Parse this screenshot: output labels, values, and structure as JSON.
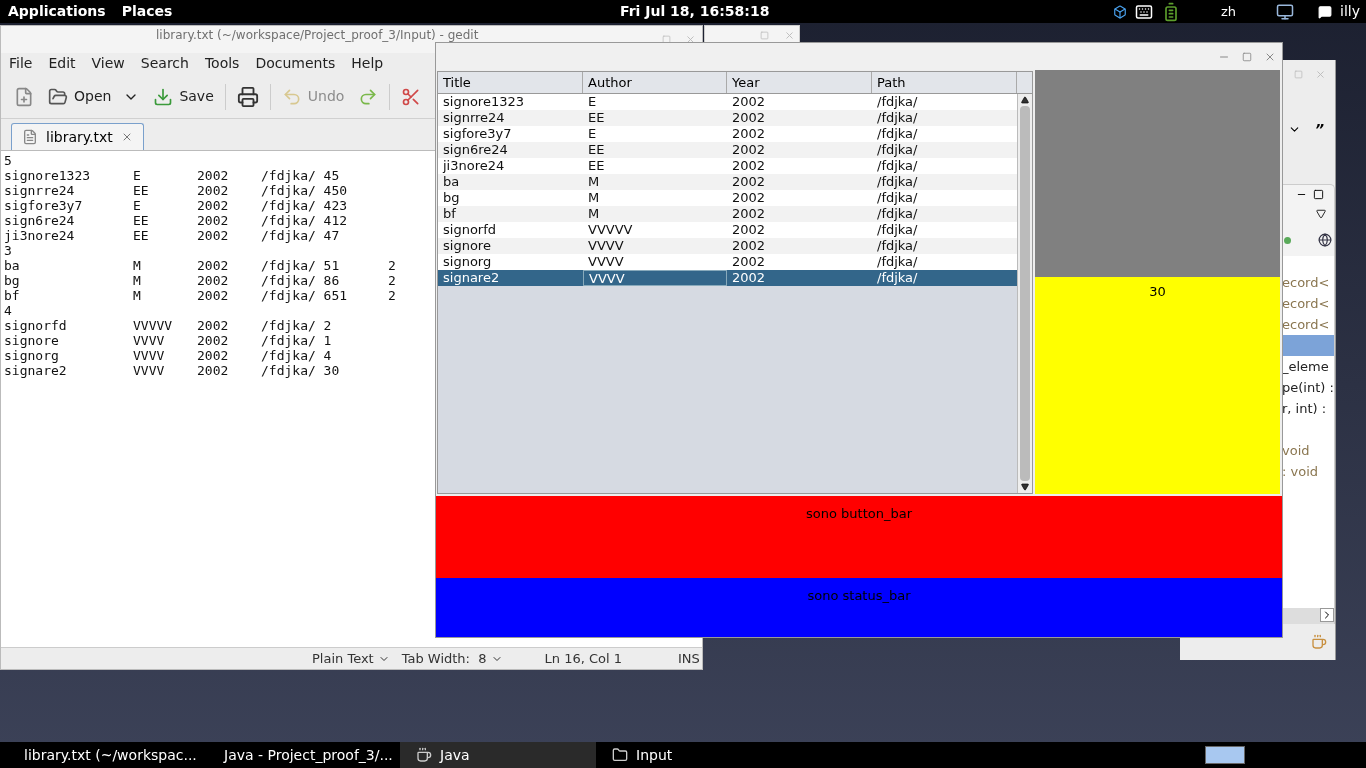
{
  "top_panel": {
    "menus": [
      "Applications",
      "Places"
    ],
    "clock": "Fri Jul 18, 16:58:18",
    "input_method": "zh",
    "user": "illy"
  },
  "gedit": {
    "title": "library.txt (~/workspace/Project_proof_3/Input) - gedit",
    "menu": [
      "File",
      "Edit",
      "View",
      "Search",
      "Tools",
      "Documents",
      "Help"
    ],
    "toolbar": [
      {
        "kind": "new",
        "disabled": false
      },
      {
        "kind": "open",
        "label": "Open",
        "disabled": false
      },
      {
        "kind": "save",
        "label": "Save",
        "disabled": false
      },
      {
        "kind": "print",
        "disabled": false
      },
      {
        "kind": "undo",
        "label": "Undo",
        "disabled": true
      },
      {
        "kind": "redo",
        "disabled": false
      },
      {
        "kind": "cut",
        "disabled": false
      }
    ],
    "tab": {
      "label": "library.txt",
      "selected": true
    },
    "lines": [
      [
        "5"
      ],
      [
        "signore1323",
        "E",
        "2002",
        "/fdjka/ 45"
      ],
      [
        "signrre24",
        "EE",
        "2002",
        "/fdjka/ 450"
      ],
      [
        "sigfore3y7",
        "E",
        "2002",
        "/fdjka/ 423"
      ],
      [
        "sign6re24",
        "EE",
        "2002",
        "/fdjka/ 412"
      ],
      [
        "ji3nore24",
        "EE",
        "2002",
        "/fdjka/ 47"
      ],
      [
        "3"
      ],
      [
        "ba",
        "M",
        "2002",
        "/fdjka/ 51",
        "2"
      ],
      [
        "bg",
        "M",
        "2002",
        "/fdjka/ 86",
        "2"
      ],
      [
        "bf",
        "M",
        "2002",
        "/fdjka/ 651",
        "2"
      ],
      [
        "4"
      ],
      [
        "signorfd",
        "VVVVV",
        "2002",
        "/fdjka/ 2"
      ],
      [
        "signore",
        "VVVV",
        "2002",
        "/fdjka/ 1"
      ],
      [
        "signorg",
        "VVVV",
        "2002",
        "/fdjka/ 4"
      ],
      [
        "signare2",
        "VVVV",
        "2002",
        "/fdjka/ 30"
      ]
    ],
    "status": {
      "language": "Plain Text",
      "tab_width": "Tab Width:  8",
      "position": "Ln 16, Col 1",
      "mode": "INS"
    }
  },
  "java_window": {
    "table": {
      "columns": [
        "Title",
        "Author",
        "Year",
        "Path"
      ],
      "rows": [
        {
          "cells": [
            "signore1323",
            "E",
            "2002",
            "/fdjka/"
          ],
          "selected": false
        },
        {
          "cells": [
            "signrre24",
            "EE",
            "2002",
            "/fdjka/"
          ],
          "selected": false
        },
        {
          "cells": [
            "sigfore3y7",
            "E",
            "2002",
            "/fdjka/"
          ],
          "selected": false
        },
        {
          "cells": [
            "sign6re24",
            "EE",
            "2002",
            "/fdjka/"
          ],
          "selected": false
        },
        {
          "cells": [
            "ji3nore24",
            "EE",
            "2002",
            "/fdjka/"
          ],
          "selected": false
        },
        {
          "cells": [
            "ba",
            "M",
            "2002",
            "/fdjka/"
          ],
          "selected": false
        },
        {
          "cells": [
            "bg",
            "M",
            "2002",
            "/fdjka/"
          ],
          "selected": false
        },
        {
          "cells": [
            "bf",
            "M",
            "2002",
            "/fdjka/"
          ],
          "selected": false
        },
        {
          "cells": [
            "signorfd",
            "VVVVV",
            "2002",
            "/fdjka/"
          ],
          "selected": false
        },
        {
          "cells": [
            "signore",
            "VVVV",
            "2002",
            "/fdjka/"
          ],
          "selected": false
        },
        {
          "cells": [
            "signorg",
            "VVVV",
            "2002",
            "/fdjka/"
          ],
          "selected": false
        },
        {
          "cells": [
            "signare2",
            "VVVV",
            "2002",
            "/fdjka/"
          ],
          "selected": true
        }
      ]
    },
    "detail_panel": {
      "text": "30"
    },
    "button_bar": {
      "text": "sono button_bar"
    },
    "status_bar": {
      "text": "sono status_bar"
    }
  },
  "eclipse": {
    "overflow_mark": "”",
    "outline": [
      {
        "text": "ecord<",
        "kind": "type",
        "selected": false
      },
      {
        "text": "ecord<",
        "kind": "type",
        "selected": false
      },
      {
        "text": "ecord<",
        "kind": "type",
        "selected": false
      },
      {
        "kind": "blank",
        "selected": true
      },
      {
        "text": "_eleme",
        "kind": "member",
        "selected": false
      },
      {
        "text": "pe(int) :",
        "kind": "member",
        "selected": false
      },
      {
        "text": "r, int) :",
        "kind": "member",
        "selected": false
      },
      {
        "kind": "blank",
        "selected": false
      },
      {
        "text": "void",
        "kind": "type",
        "selected": false
      },
      {
        "text": ": void",
        "kind": "type",
        "selected": false
      }
    ]
  },
  "taskbar": [
    {
      "label": "library.txt (~/workspac...",
      "kind": "editor",
      "selected": false
    },
    {
      "label": "Java - Project_proof_3/...",
      "kind": "ide",
      "selected": false
    },
    {
      "label": "Java",
      "kind": "java",
      "selected": true
    },
    {
      "label": "Input",
      "kind": "folder",
      "selected": false
    }
  ]
}
